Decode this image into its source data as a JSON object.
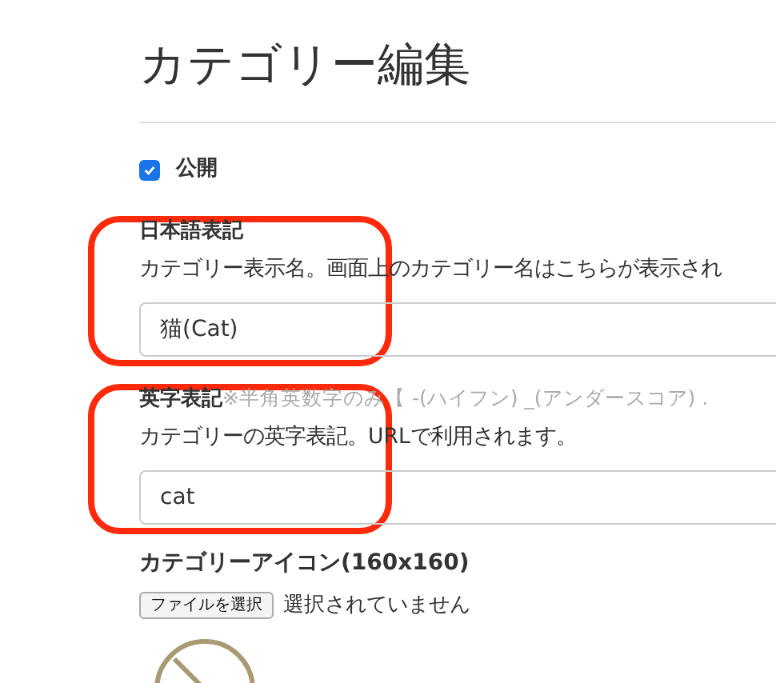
{
  "page": {
    "title": "カテゴリー編集"
  },
  "published": {
    "label": "公開",
    "checked": true
  },
  "fields": [
    {
      "label": "日本語表記",
      "description": "カテゴリー表示名。画面上のカテゴリー名はこちらが表示され",
      "value": "猫(Cat)"
    },
    {
      "label": "英字表記",
      "note": "※半角英数字のみ【 -(ハイフン) _(アンダースコア) .",
      "description": "カテゴリーの英字表記。URLで利用されます。",
      "value": "cat"
    }
  ],
  "icon_upload": {
    "label": "カテゴリーアイコン(160x160)",
    "button": "ファイルを選択",
    "status": "選択されていません"
  }
}
